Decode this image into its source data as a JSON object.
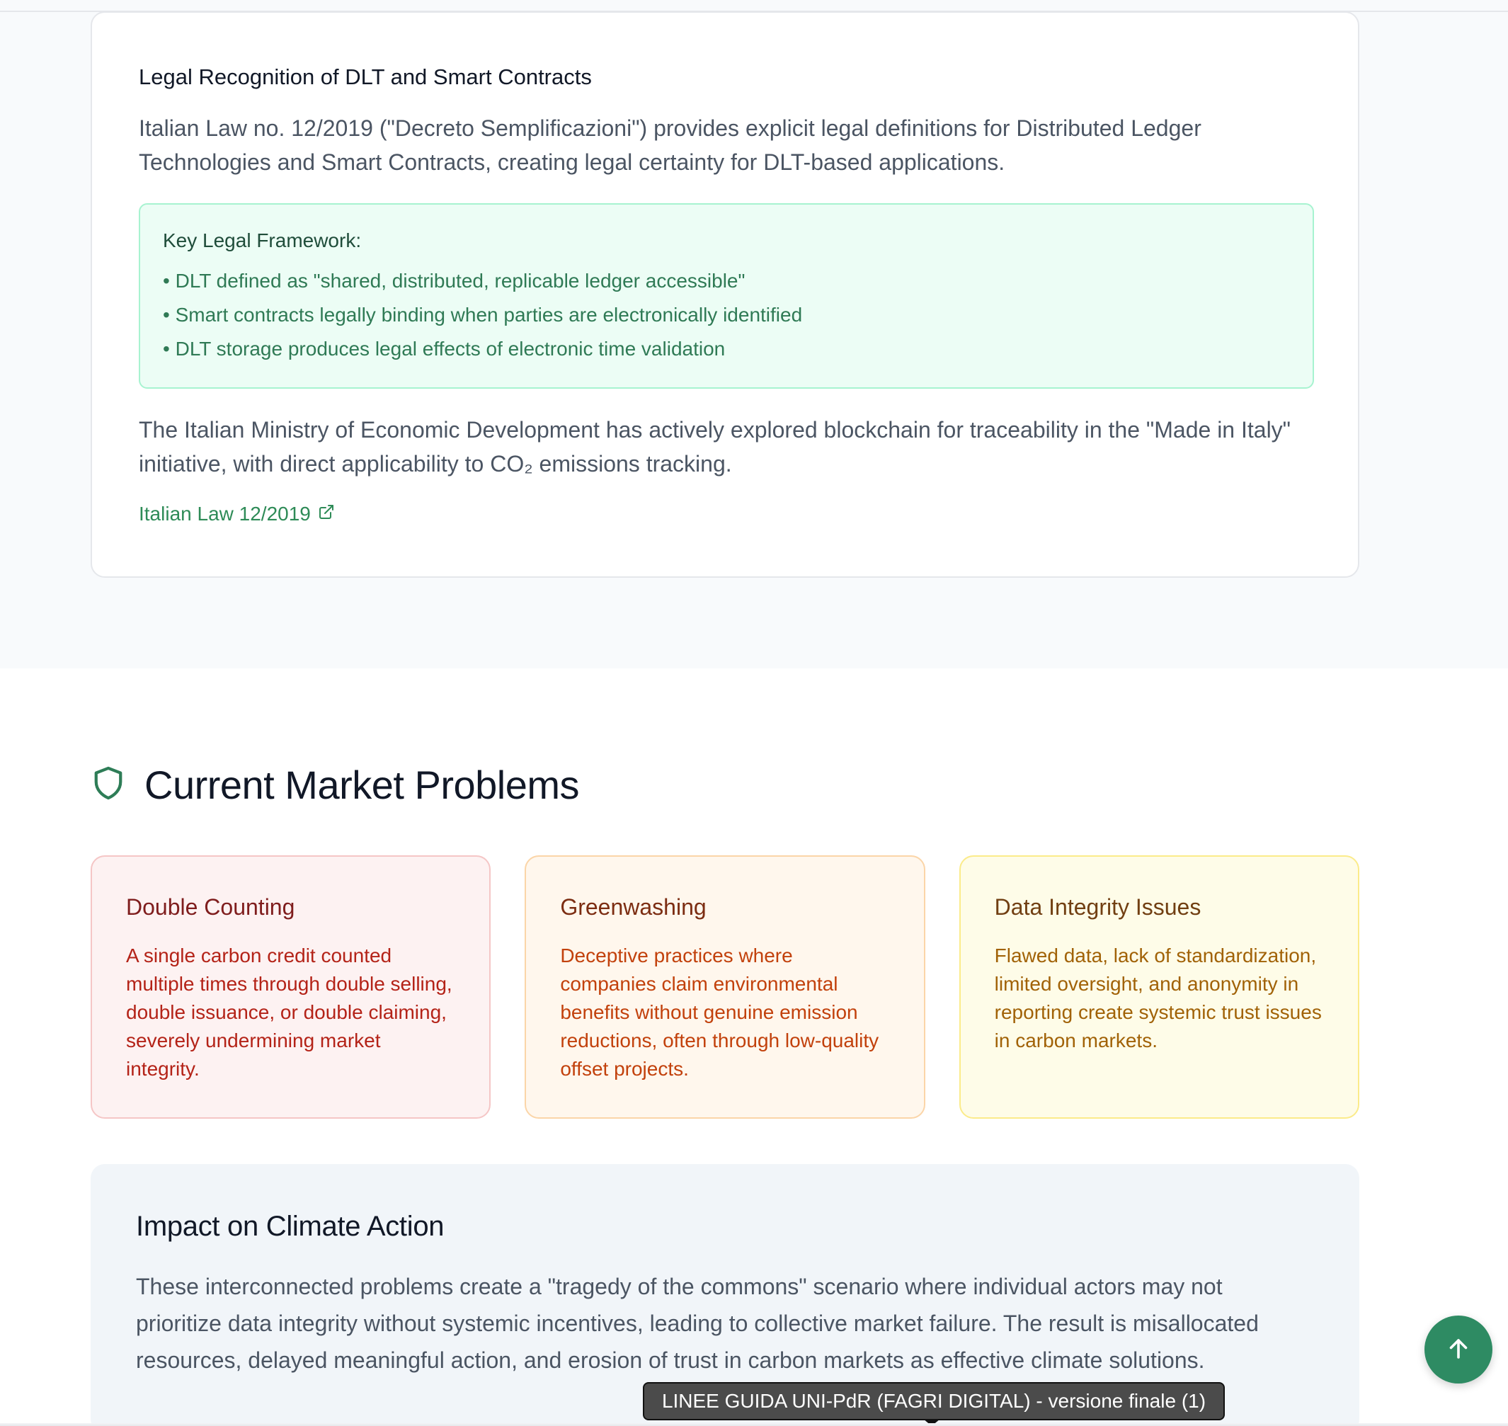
{
  "legal": {
    "title": "Legal Recognition of DLT and Smart Contracts",
    "intro": "Italian Law no. 12/2019 (\"Decreto Semplificazioni\") provides explicit legal definitions for Distributed Ledger Technologies and Smart Contracts, creating legal certainty for DLT-based applications.",
    "framework_title": "Key Legal Framework:",
    "framework_items": [
      "DLT defined as \"shared, distributed, replicable ledger accessible\"",
      "Smart contracts legally binding when parties are electronically identified",
      "DLT storage produces legal effects of electronic time validation"
    ],
    "ministry": "The Italian Ministry of Economic Development has actively explored blockchain for traceability in the \"Made in Italy\" initiative, with direct applicability to CO₂ emissions tracking.",
    "link_label": "Italian Law 12/2019"
  },
  "problems_section": {
    "title": "Current Market Problems",
    "icon": "shield-icon",
    "cards": [
      {
        "title": "Double Counting",
        "text": "A single carbon credit counted multiple times through double selling, double issuance, or double claiming, severely undermining market integrity."
      },
      {
        "title": "Greenwashing",
        "text": "Deceptive practices where companies claim environmental benefits without genuine emission reductions, often through low-quality offset projects."
      },
      {
        "title": "Data Integrity Issues",
        "text": "Flawed data, lack of standardization, limited oversight, and anonymity in reporting create systemic trust issues in carbon markets."
      }
    ]
  },
  "impact": {
    "title": "Impact on Climate Action",
    "text": "These interconnected problems create a \"tragedy of the commons\" scenario where individual actors may not prioritize data integrity without systemic incentives, leading to collective market failure. The result is misallocated resources, delayed meaningful action, and erosion of trust in carbon markets as effective climate solutions."
  },
  "scroll_top_button": {
    "icon": "arrow-up-icon"
  },
  "tooltip": {
    "text": "LINEE GUIDA UNI-PdR (FAGRI DIGITAL) - versione finale (1)"
  },
  "colors": {
    "accent_green": "#2e8b63",
    "framework_bg": "#ecfdf5",
    "red_card_bg": "#fdf2f2",
    "orange_card_bg": "#fff7ed",
    "yellow_card_bg": "#fefce8"
  }
}
